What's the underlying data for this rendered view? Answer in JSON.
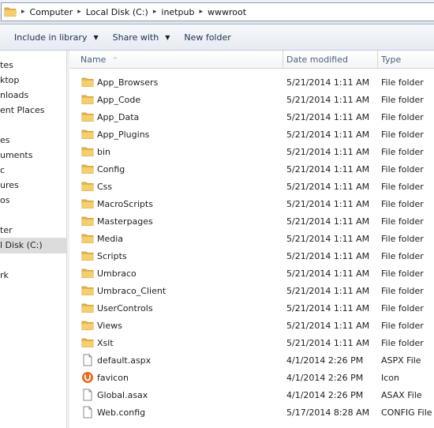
{
  "address": {
    "crumbs": [
      "Computer",
      "Local Disk (C:)",
      "inetpub",
      "wwwroot"
    ]
  },
  "toolbar": {
    "include_label": "Include in library",
    "share_label": "Share with",
    "newfolder_label": "New folder"
  },
  "nav": {
    "items": [
      {
        "label": "tes",
        "selected": false
      },
      {
        "label": "ktop",
        "selected": false
      },
      {
        "label": "nloads",
        "selected": false
      },
      {
        "label": "ent Places",
        "selected": false
      },
      {
        "label": "es",
        "selected": false
      },
      {
        "label": "uments",
        "selected": false
      },
      {
        "label": "c",
        "selected": false
      },
      {
        "label": "ures",
        "selected": false
      },
      {
        "label": "os",
        "selected": false
      },
      {
        "label": "ter",
        "selected": false
      },
      {
        "label": "l Disk (C:)",
        "selected": true
      },
      {
        "label": "rk",
        "selected": false
      }
    ]
  },
  "columns": {
    "name": "Name",
    "date": "Date modified",
    "type": "Type",
    "sort_indicator": "^"
  },
  "colors": {
    "folder": "#e8b64a",
    "folder_dark": "#c9902a",
    "umbraco": "#e76b24",
    "header_text": "#4c607a",
    "selected_nav": "#dcdcdc"
  },
  "files": [
    {
      "name": "App_Browsers",
      "date": "5/21/2014 1:11 AM",
      "type": "File folder",
      "icon": "folder-icon"
    },
    {
      "name": "App_Code",
      "date": "5/21/2014 1:11 AM",
      "type": "File folder",
      "icon": "folder-icon"
    },
    {
      "name": "App_Data",
      "date": "5/21/2014 1:11 AM",
      "type": "File folder",
      "icon": "folder-icon"
    },
    {
      "name": "App_Plugins",
      "date": "5/21/2014 1:11 AM",
      "type": "File folder",
      "icon": "folder-icon"
    },
    {
      "name": "bin",
      "date": "5/21/2014 1:11 AM",
      "type": "File folder",
      "icon": "folder-icon"
    },
    {
      "name": "Config",
      "date": "5/21/2014 1:11 AM",
      "type": "File folder",
      "icon": "folder-icon"
    },
    {
      "name": "Css",
      "date": "5/21/2014 1:11 AM",
      "type": "File folder",
      "icon": "folder-icon"
    },
    {
      "name": "MacroScripts",
      "date": "5/21/2014 1:11 AM",
      "type": "File folder",
      "icon": "folder-icon"
    },
    {
      "name": "Masterpages",
      "date": "5/21/2014 1:11 AM",
      "type": "File folder",
      "icon": "folder-icon"
    },
    {
      "name": "Media",
      "date": "5/21/2014 1:11 AM",
      "type": "File folder",
      "icon": "folder-icon"
    },
    {
      "name": "Scripts",
      "date": "5/21/2014 1:11 AM",
      "type": "File folder",
      "icon": "folder-icon"
    },
    {
      "name": "Umbraco",
      "date": "5/21/2014 1:11 AM",
      "type": "File folder",
      "icon": "folder-icon"
    },
    {
      "name": "Umbraco_Client",
      "date": "5/21/2014 1:11 AM",
      "type": "File folder",
      "icon": "folder-icon"
    },
    {
      "name": "UserControls",
      "date": "5/21/2014 1:11 AM",
      "type": "File folder",
      "icon": "folder-icon"
    },
    {
      "name": "Views",
      "date": "5/21/2014 1:11 AM",
      "type": "File folder",
      "icon": "folder-icon"
    },
    {
      "name": "Xslt",
      "date": "5/21/2014 1:11 AM",
      "type": "File folder",
      "icon": "folder-icon"
    },
    {
      "name": "default.aspx",
      "date": "4/1/2014 2:26 PM",
      "type": "ASPX File",
      "icon": "file-icon"
    },
    {
      "name": "favicon",
      "date": "4/1/2014 2:26 PM",
      "type": "Icon",
      "icon": "umbraco-icon"
    },
    {
      "name": "Global.asax",
      "date": "4/1/2014 2:26 PM",
      "type": "ASAX File",
      "icon": "file-icon"
    },
    {
      "name": "Web.config",
      "date": "5/17/2014 8:28 AM",
      "type": "CONFIG File",
      "icon": "file-icon"
    }
  ]
}
